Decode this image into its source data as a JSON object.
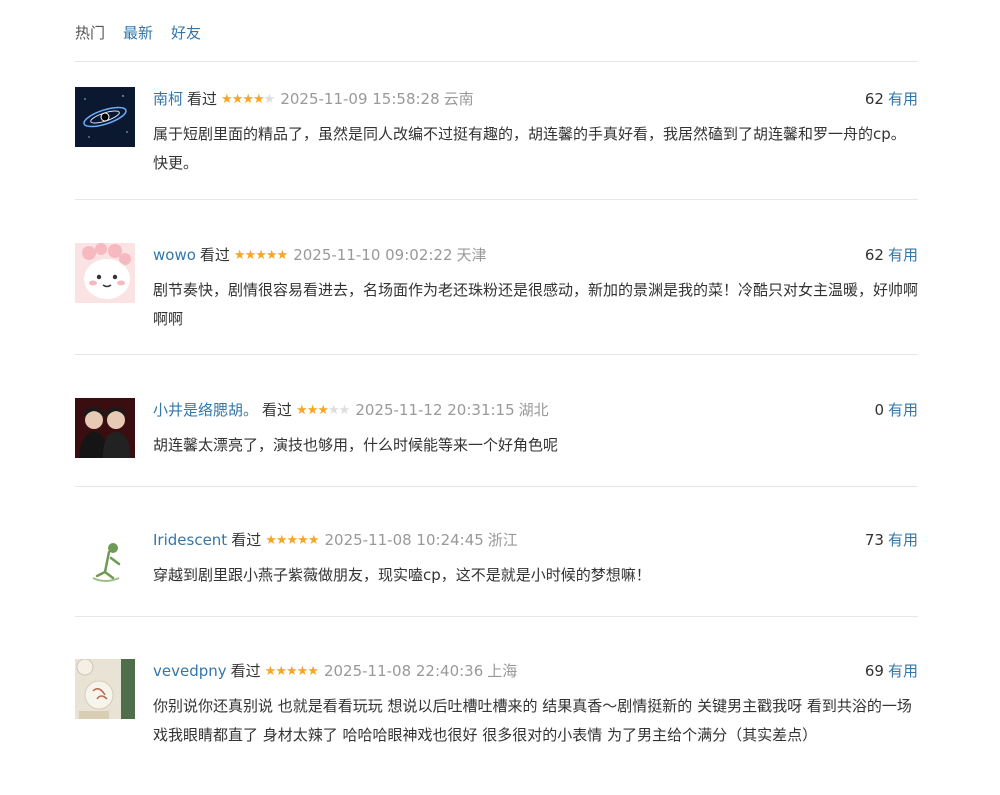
{
  "tabs": {
    "hot": "热门",
    "latest": "最新",
    "friends": "好友",
    "active": "hot"
  },
  "comments": [
    {
      "user": "南柯",
      "status": "看过",
      "rating": 4,
      "time": "2025-11-09 15:58:28",
      "location": "云南",
      "votes": "62",
      "useful_label": "有用",
      "text": "属于短剧里面的精品了，虽然是同人改编不过挺有趣的，胡连馨的手真好看，我居然磕到了胡连馨和罗一舟的cp。快更。"
    },
    {
      "user": "wowo",
      "status": "看过",
      "rating": 5,
      "time": "2025-11-10 09:02:22",
      "location": "天津",
      "votes": "62",
      "useful_label": "有用",
      "text": "剧节奏快，剧情很容易看进去，名场面作为老还珠粉还是很感动，新加的景渊是我的菜！冷酷只对女主温暖，好帅啊啊啊"
    },
    {
      "user": "小井是络腮胡。",
      "status": "看过",
      "rating": 3,
      "time": "2025-11-12 20:31:15",
      "location": "湖北",
      "votes": "0",
      "useful_label": "有用",
      "text": "胡连馨太漂亮了，演技也够用，什么时候能等来一个好角色呢"
    },
    {
      "user": "Iridescent",
      "status": "看过",
      "rating": 5,
      "time": "2025-11-08 10:24:45",
      "location": "浙江",
      "votes": "73",
      "useful_label": "有用",
      "text": "穿越到剧里跟小燕子紫薇做朋友，现实嗑cp，这不是就是小时候的梦想嘛！"
    },
    {
      "user": "vevedpny",
      "status": "看过",
      "rating": 5,
      "time": "2025-11-08 22:40:36",
      "location": "上海",
      "votes": "69",
      "useful_label": "有用",
      "text": "你别说你还真别说 也就是看看玩玩 想说以后吐槽吐槽来的 结果真香～剧情挺新的 关键男主戳我呀 看到共浴的一场戏我眼睛都直了 身材太辣了 哈哈哈眼神戏也很好 很多很对的小表情 为了男主给个满分（其实差点）"
    }
  ],
  "colors": {
    "link": "#3377aa",
    "star": "#f5a623",
    "muted": "#999999"
  }
}
